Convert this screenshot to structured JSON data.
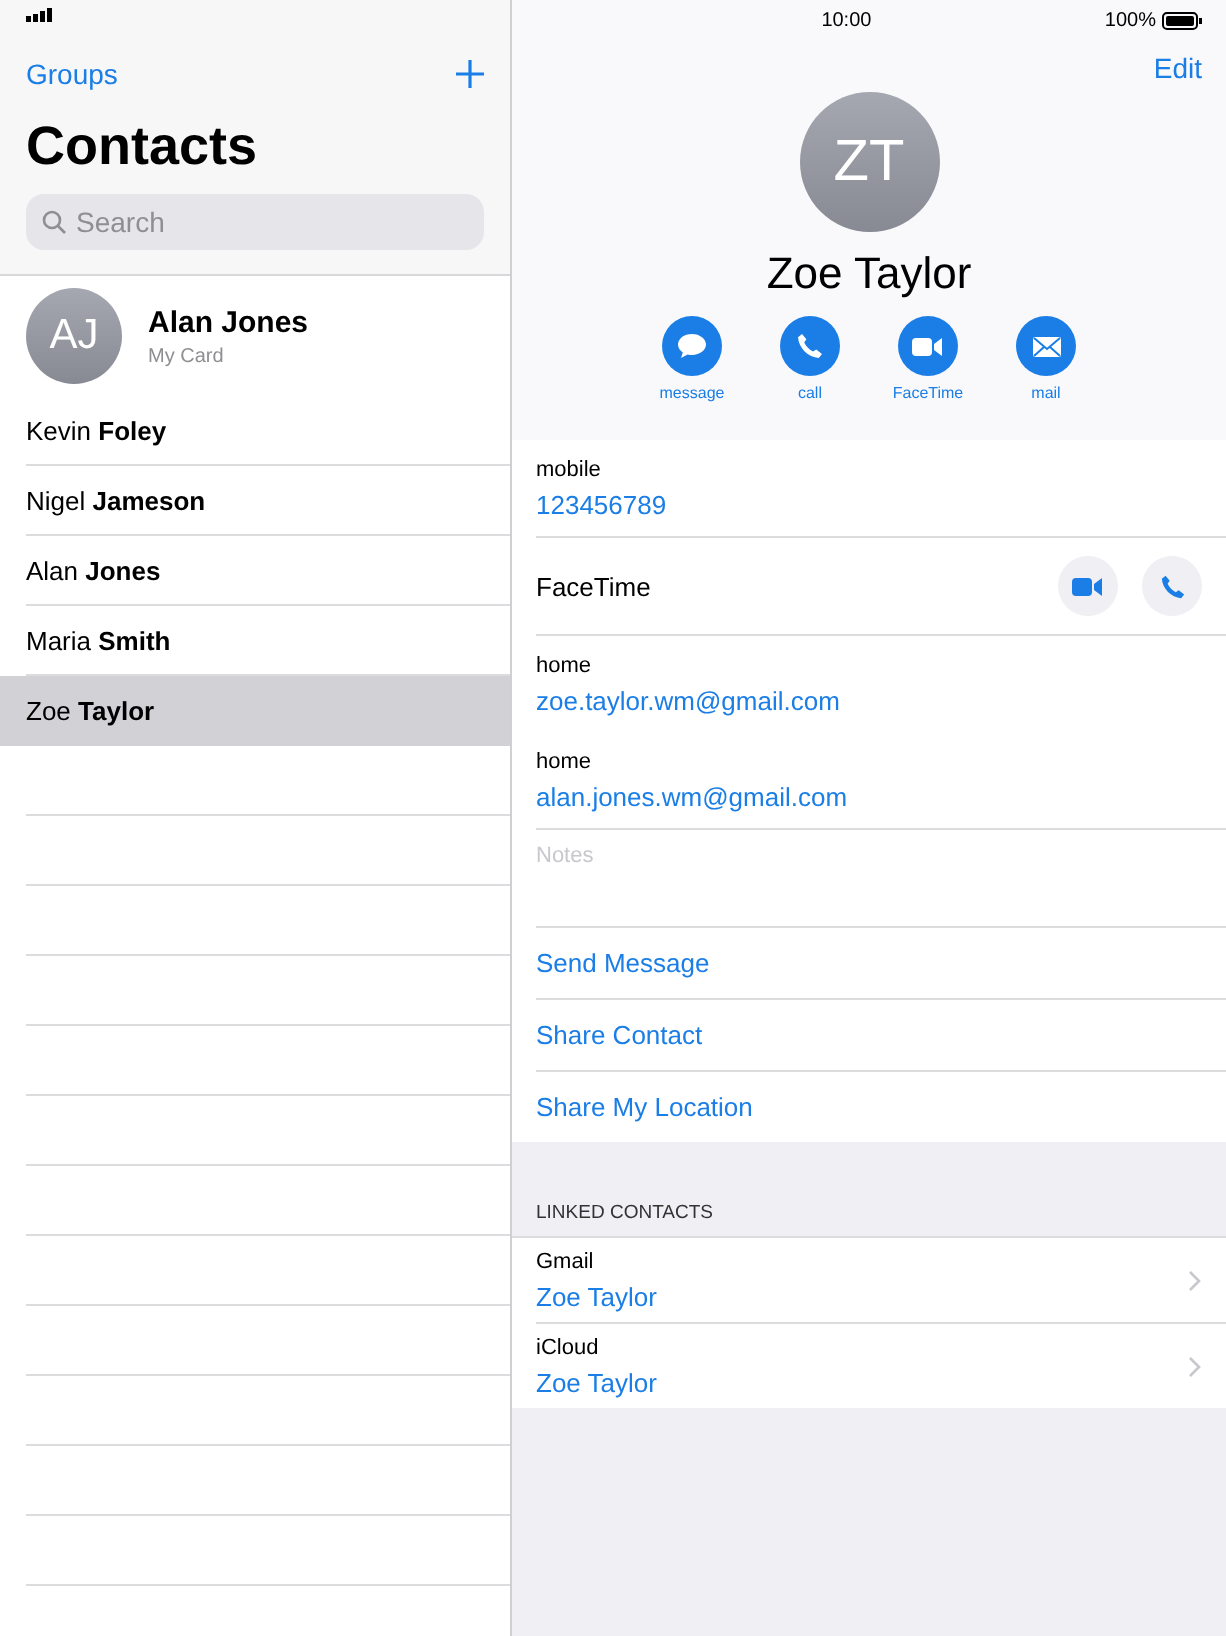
{
  "status_bar": {
    "time": "10:00",
    "battery": "100%"
  },
  "sidebar": {
    "groups_link": "Groups",
    "title": "Contacts",
    "search": {
      "placeholder": "Search"
    },
    "my_card": {
      "initials": "AJ",
      "name": "Alan Jones",
      "subtitle": "My Card"
    },
    "contacts": [
      {
        "name": "Kevin **Foley**",
        "selected": false
      },
      {
        "name": "Nigel **Jameson**",
        "selected": false
      },
      {
        "name": "Alan **Jones**",
        "selected": false
      },
      {
        "name": "Maria **Smith**",
        "selected": false
      },
      {
        "name": "Zoe **Taylor**",
        "selected": true
      }
    ]
  },
  "detail": {
    "edit": "Edit",
    "initials": "ZT",
    "name": "Zoe Taylor",
    "actions": [
      {
        "kind": "message",
        "label": "message"
      },
      {
        "kind": "call",
        "label": "call"
      },
      {
        "kind": "video",
        "label": "FaceTime"
      },
      {
        "kind": "mail",
        "label": "mail"
      }
    ],
    "fields": [
      {
        "kind": "value",
        "label": "mobile",
        "value": "123456789",
        "divider": true
      },
      {
        "kind": "facetime",
        "label": "FaceTime",
        "divider": true
      },
      {
        "kind": "value",
        "label": "home",
        "value": "zoe.taylor.wm@gmail.com",
        "divider": false
      },
      {
        "kind": "value",
        "label": "home",
        "value": "alan.jones.wm@gmail.com",
        "divider": true
      },
      {
        "kind": "notes",
        "placeholder": "Notes",
        "divider": true
      }
    ],
    "links": [
      "Send Message",
      "Share Contact",
      "Share My Location"
    ],
    "linked_header": "LINKED CONTACTS",
    "linked": [
      {
        "source": "Gmail",
        "name": "Zoe Taylor"
      },
      {
        "source": "iCloud",
        "name": "Zoe Taylor"
      }
    ]
  }
}
